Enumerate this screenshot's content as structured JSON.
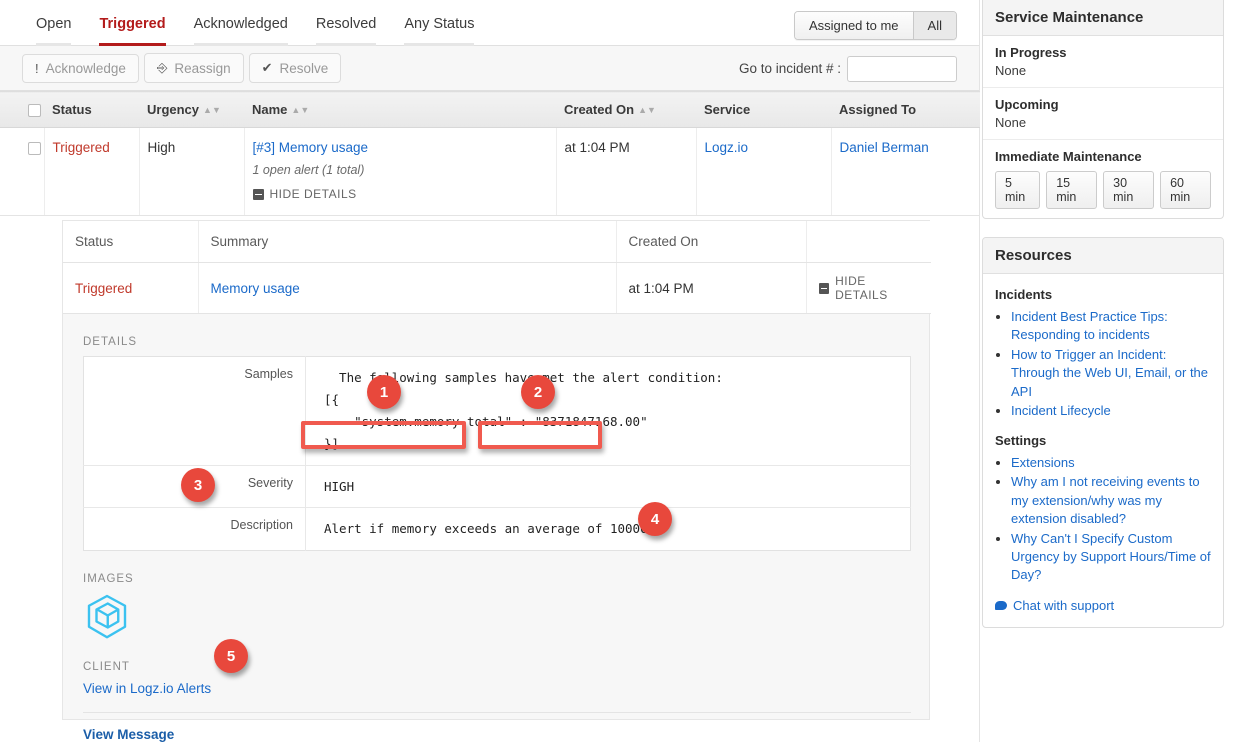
{
  "tabs": [
    {
      "label": "Open",
      "active": false
    },
    {
      "label": "Triggered",
      "active": true
    },
    {
      "label": "Acknowledged",
      "active": false
    },
    {
      "label": "Resolved",
      "active": false
    },
    {
      "label": "Any Status",
      "active": false
    }
  ],
  "assignment_filter": {
    "assigned_to_me": "Assigned to me",
    "all": "All",
    "selected": "All"
  },
  "actions": {
    "acknowledge": "Acknowledge",
    "acknowledge_icon": "exclamation-icon",
    "reassign": "Reassign",
    "reassign_icon": "share-icon",
    "resolve": "Resolve",
    "resolve_icon": "check-icon"
  },
  "goto_incident": {
    "label": "Go to incident # :",
    "value": "",
    "placeholder": ""
  },
  "incident_table": {
    "columns": [
      "Status",
      "Urgency",
      "Name",
      "Created On",
      "Service",
      "Assigned To"
    ],
    "sortable": [
      "Urgency",
      "Name",
      "Created On"
    ],
    "rows": [
      {
        "status": "Triggered",
        "urgency": "High",
        "name": "[#3] Memory usage",
        "alerts": "1 open alert (1 total)",
        "toggle": "HIDE DETAILS",
        "created_on": "at 1:04 PM",
        "service": "Logz.io",
        "assigned_to": "Daniel Berman"
      }
    ]
  },
  "detail": {
    "columns": [
      "Status",
      "Summary",
      "Created On",
      ""
    ],
    "row": {
      "status": "Triggered",
      "summary": "Memory usage",
      "created_on": "at 1:04 PM",
      "toggle": "HIDE DETAILS"
    },
    "details_label": "DETAILS",
    "fields": [
      {
        "key": "Samples",
        "value": "  The following samples have met the alert condition:\n[{\n    \"system.memory.total\" : \"8371847168.00\"\n}]"
      },
      {
        "key": "Severity",
        "value": "HIGH"
      },
      {
        "key": "Description",
        "value": "Alert if memory exceeds an average of 1000000"
      }
    ],
    "images_label": "IMAGES",
    "image_icon": "logzio-cube-logo",
    "client_label": "CLIENT",
    "client_link": "View in Logz.io Alerts",
    "view_message": "View Message"
  },
  "sidebar": {
    "service_maintenance": {
      "title": "Service Maintenance",
      "sections": [
        {
          "title": "In Progress",
          "value": "None"
        },
        {
          "title": "Upcoming",
          "value": "None"
        }
      ],
      "immediate_title": "Immediate Maintenance",
      "immediate_buttons": [
        "5 min",
        "15 min",
        "30 min",
        "60 min"
      ]
    },
    "resources": {
      "title": "Resources",
      "groups": [
        {
          "heading": "Incidents",
          "links": [
            "Incident Best Practice Tips: Responding to incidents",
            "How to Trigger an Incident: Through the Web UI, Email, or the API",
            "Incident Lifecycle"
          ]
        },
        {
          "heading": "Settings",
          "links": [
            "Extensions",
            "Why am I not receiving events to my extension/why was my extension disabled?",
            "Why Can't I Specify Custom Urgency by Support Hours/Time of Day?"
          ]
        }
      ],
      "chat": "Chat with support",
      "chat_icon": "chat-bubble-icon"
    }
  },
  "annotations": {
    "markers": [
      "1",
      "2",
      "3",
      "4",
      "5"
    ],
    "marker_color": "#e8483c",
    "highlight_color": "#f05a4f"
  },
  "colors": {
    "accent_red": "#b31b1b",
    "status_red": "#c0392b",
    "link_blue": "#1b6ac9",
    "logo_cyan": "#3bc2f0"
  }
}
